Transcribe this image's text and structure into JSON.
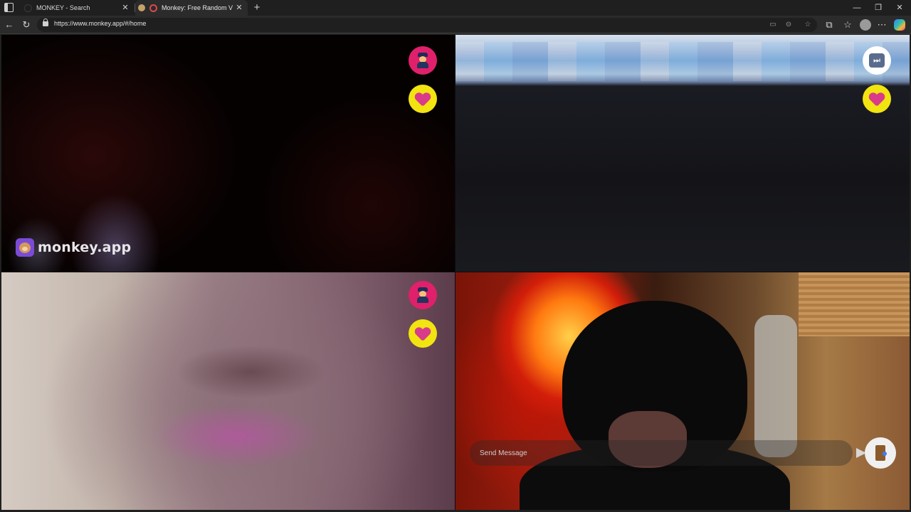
{
  "browser": {
    "tabs": [
      {
        "title": "MONKEY - Search",
        "active": false
      },
      {
        "title": "Monkey: Free Random Video Chat",
        "active": true
      }
    ],
    "url": "https://www.monkey.app/#/home",
    "window_controls": [
      "minimize-icon",
      "restore-icon",
      "close-icon"
    ]
  },
  "app": {
    "watermark": "monkey.app",
    "chat": {
      "placeholder": "Send Message",
      "value": ""
    },
    "panes": [
      {
        "position": "top-left",
        "buttons": [
          "police-icon",
          "heart-gift-icon"
        ]
      },
      {
        "position": "top-right",
        "buttons": [
          "skip-icon",
          "heart-gift-icon"
        ]
      },
      {
        "position": "bottom-left",
        "buttons": [
          "police-icon",
          "heart-gift-icon"
        ]
      },
      {
        "position": "bottom-right",
        "buttons": [
          "send-icon",
          "leave-door-icon"
        ]
      }
    ],
    "colors": {
      "police_btn": "#e0206a",
      "heart_btn": "#f2e410",
      "skip_btn": "#ffffff",
      "brand_purple": "#7b4bd8"
    }
  }
}
